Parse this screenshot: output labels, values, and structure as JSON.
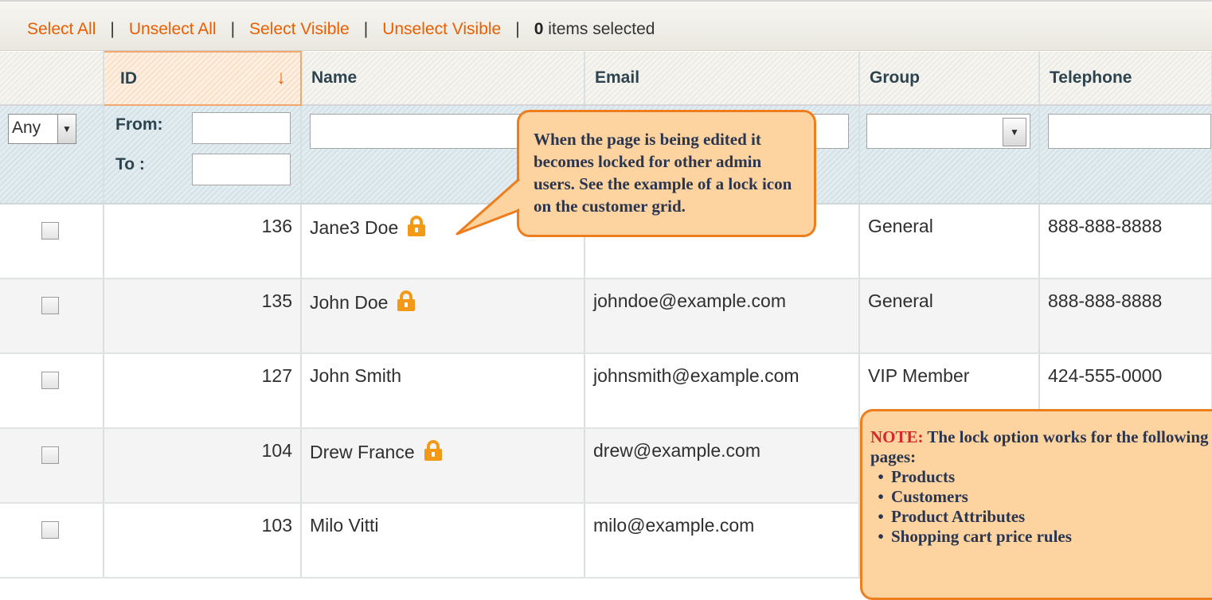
{
  "massaction": {
    "select_all": "Select All",
    "unselect_all": "Unselect All",
    "select_visible": "Select Visible",
    "unselect_visible": "Unselect Visible",
    "separator": "|",
    "selected_count": "0",
    "selected_label": "items selected"
  },
  "grid": {
    "headers": {
      "id": "ID",
      "name": "Name",
      "email": "Email",
      "group": "Group",
      "telephone": "Telephone"
    },
    "sort_arrow": "↓",
    "filters": {
      "massaction_select_value": "Any",
      "from_label": "From:",
      "to_label": "To :"
    },
    "rows": [
      {
        "id": "136",
        "name": "Jane3 Doe",
        "locked": true,
        "email": "",
        "group": "General",
        "telephone": "888-888-8888"
      },
      {
        "id": "135",
        "name": "John Doe",
        "locked": true,
        "email": "johndoe@example.com",
        "group": "General",
        "telephone": "888-888-8888"
      },
      {
        "id": "127",
        "name": "John Smith",
        "locked": false,
        "email": "johnsmith@example.com",
        "group": "VIP Member",
        "telephone": "424-555-0000"
      },
      {
        "id": "104",
        "name": "Drew France",
        "locked": true,
        "email": "drew@example.com",
        "group": "",
        "telephone": ""
      },
      {
        "id": "103",
        "name": "Milo Vitti",
        "locked": false,
        "email": "milo@example.com",
        "group": "",
        "telephone": ""
      }
    ]
  },
  "callout_lock": {
    "text": "When the page is being edited it becomes locked for other admin users. See the example of a lock icon on the customer grid."
  },
  "callout_note": {
    "note_label": "NOTE:",
    "note_text": "The lock option works for the following pages:",
    "items": [
      "Products",
      "Customers",
      "Product Attributes",
      "Shopping cart price rules"
    ]
  },
  "colors": {
    "link_orange": "#eb5e00",
    "callout_fill": "#fdd39f",
    "callout_border": "#ee7d1d",
    "lock_icon": "#f29a17",
    "note_red": "#d7262c"
  }
}
